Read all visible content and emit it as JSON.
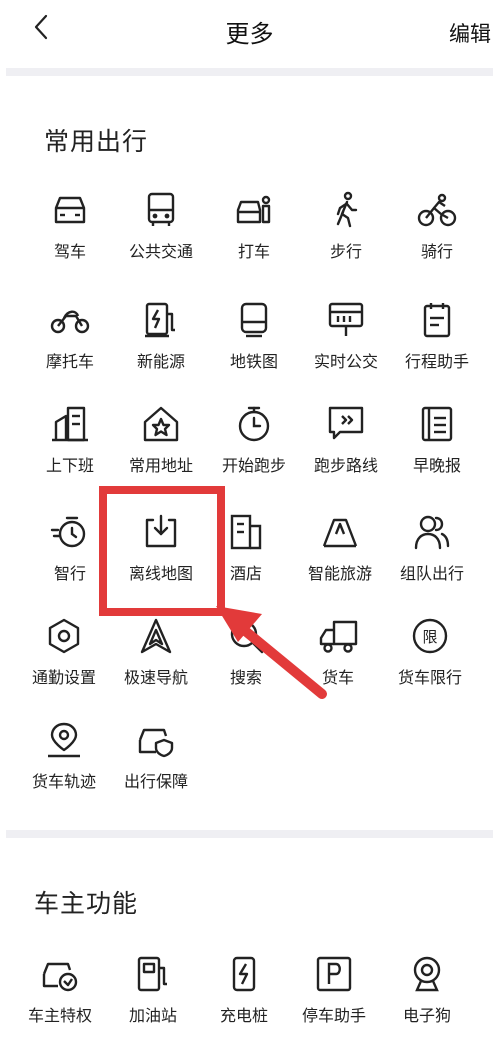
{
  "header": {
    "title": "更多",
    "edit_label": "编辑"
  },
  "sections": [
    {
      "title": "常用出行",
      "items": [
        {
          "label": "驾车",
          "icon": "car-icon"
        },
        {
          "label": "公共交通",
          "icon": "bus-icon"
        },
        {
          "label": "打车",
          "icon": "taxi-icon"
        },
        {
          "label": "步行",
          "icon": "walk-icon"
        },
        {
          "label": "骑行",
          "icon": "bike-icon"
        },
        {
          "label": "摩托车",
          "icon": "motorcycle-icon"
        },
        {
          "label": "新能源",
          "icon": "charger-icon"
        },
        {
          "label": "地铁图",
          "icon": "subway-icon"
        },
        {
          "label": "实时公交",
          "icon": "bus-stop-icon"
        },
        {
          "label": "行程助手",
          "icon": "itinerary-icon"
        },
        {
          "label": "上下班",
          "icon": "commute-icon"
        },
        {
          "label": "常用地址",
          "icon": "home-star-icon"
        },
        {
          "label": "开始跑步",
          "icon": "stopwatch-icon"
        },
        {
          "label": "跑步路线",
          "icon": "run-route-icon"
        },
        {
          "label": "早晚报",
          "icon": "news-icon"
        },
        {
          "label": "智行",
          "icon": "smart-travel-icon"
        },
        {
          "label": "离线地图",
          "icon": "download-map-icon"
        },
        {
          "label": "酒店",
          "icon": "hotel-icon"
        },
        {
          "label": "智能旅游",
          "icon": "scenic-icon"
        },
        {
          "label": "组队出行",
          "icon": "group-icon"
        },
        {
          "label": "通勤设置",
          "icon": "hexagon-settings-icon"
        },
        {
          "label": "极速导航",
          "icon": "navigation-icon"
        },
        {
          "label": "搜索",
          "icon": "search-icon"
        },
        {
          "label": "货车",
          "icon": "truck-icon"
        },
        {
          "label": "货车限行",
          "icon": "truck-limit-icon"
        },
        {
          "label": "货车轨迹",
          "icon": "truck-track-icon"
        },
        {
          "label": "出行保障",
          "icon": "car-shield-icon"
        }
      ]
    },
    {
      "title": "车主功能",
      "items": [
        {
          "label": "车主特权",
          "icon": "car-badge-icon"
        },
        {
          "label": "加油站",
          "icon": "gas-station-icon"
        },
        {
          "label": "充电桩",
          "icon": "charging-pile-icon"
        },
        {
          "label": "停车助手",
          "icon": "parking-icon"
        },
        {
          "label": "电子狗",
          "icon": "camera-icon"
        }
      ]
    }
  ],
  "highlight": {
    "target": "离线地图",
    "color": "#e23a3a"
  }
}
